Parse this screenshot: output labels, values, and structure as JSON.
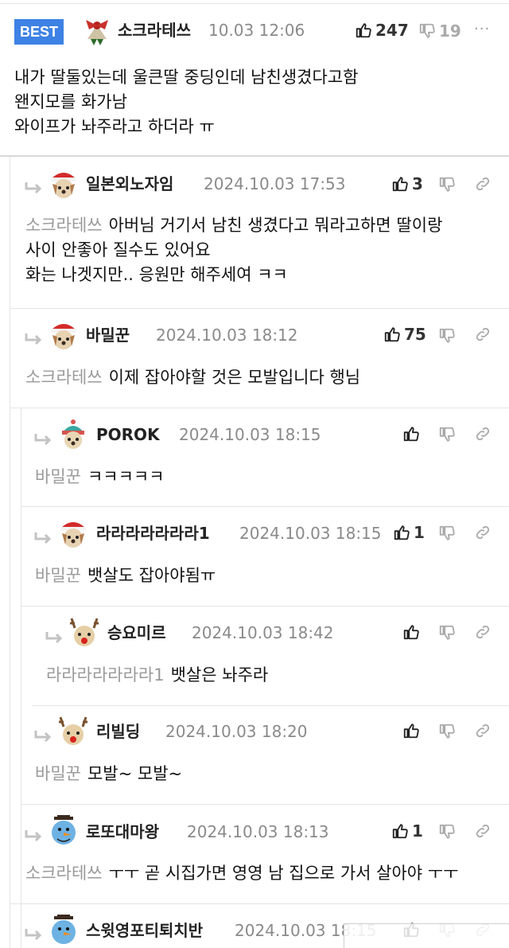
{
  "best_comment": {
    "badge": "BEST",
    "author": "소크라테쓰",
    "date": "10.03 12:06",
    "likes": "247",
    "dislikes": "19",
    "more": "···",
    "lines": [
      "내가 딸둘있는데 울큰딸 중딩인데 남친생겼다고함",
      "왠지모를 화가남",
      "와이프가 놔주라고 하더라 ㅠ"
    ]
  },
  "replies": [
    {
      "author": "일본외노자임",
      "date": "2024.10.03 17:53",
      "likes": "3",
      "mention": "소크라테쓰",
      "lines": [
        "아버님 거기서 남친 생겼다고 뭐라고하면 딸이랑",
        "사이 안좋아 질수도 있어요",
        "화는 나겟지만.. 응원만 해주세여 ㅋㅋ"
      ]
    },
    {
      "author": "바밀꾼",
      "date": "2024.10.03 18:12",
      "likes": "75",
      "mention": "소크라테쓰",
      "lines": [
        "이제 잡아야할 것은 모발입니다 행님"
      ]
    },
    {
      "author": "POROK",
      "date": "2024.10.03 18:15",
      "likes": "",
      "mention": "바밀꾼",
      "lines": [
        "ㅋㅋㅋㅋㅋ"
      ]
    },
    {
      "author": "라라라라라라라1",
      "date": "2024.10.03 18:15",
      "likes": "1",
      "mention": "바밀꾼",
      "lines": [
        "뱃살도 잡아야됨ㅠ"
      ]
    },
    {
      "author": "승요미르",
      "date": "2024.10.03 18:42",
      "likes": "",
      "mention": "라라라라라라라1",
      "lines": [
        "뱃살은 놔주라"
      ]
    },
    {
      "author": "리빌딩",
      "date": "2024.10.03 18:20",
      "likes": "",
      "mention": "바밀꾼",
      "lines": [
        "모발~ 모발~"
      ]
    },
    {
      "author": "로또대마왕",
      "date": "2024.10.03 18:13",
      "likes": "1",
      "mention": "소크라테쓰",
      "lines": [
        "ㅜㅜ 곧 시집가면 영영 남 집으로 가서 살아야 ㅜㅜ"
      ]
    },
    {
      "author": "스윗영포티퇴치반",
      "date": "2024.10.03 18:15",
      "likes": "",
      "mention": "",
      "lines": []
    }
  ],
  "colors": {
    "badge": "#3d82e4",
    "mention": "#9a9a9a",
    "date": "#8a8a8a"
  },
  "icons": [
    "thumbs-up-icon",
    "thumbs-down-icon",
    "link-icon",
    "reply-arrow-icon",
    "more-icon"
  ]
}
